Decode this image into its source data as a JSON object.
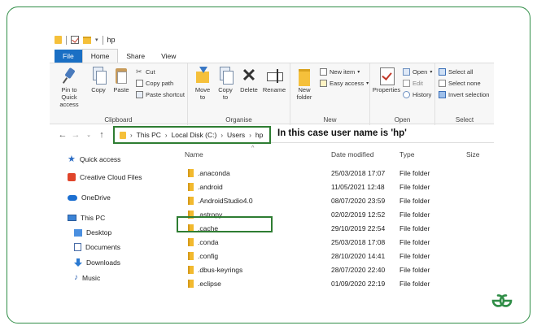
{
  "window": {
    "title": "hp",
    "tabs": [
      "File",
      "Home",
      "Share",
      "View"
    ]
  },
  "ribbon": {
    "clipboard": {
      "label": "Clipboard",
      "pin": "Pin to Quick access",
      "copy": "Copy",
      "paste": "Paste",
      "cut": "Cut",
      "copy_path": "Copy path",
      "paste_shortcut": "Paste shortcut"
    },
    "organise": {
      "label": "Organise",
      "move_to": "Move to",
      "copy_to": "Copy to",
      "delete": "Delete",
      "rename": "Rename"
    },
    "new": {
      "label": "New",
      "new_folder": "New folder",
      "new_item": "New item",
      "easy_access": "Easy access"
    },
    "open": {
      "label": "Open",
      "properties": "Properties",
      "open": "Open",
      "edit": "Edit",
      "history": "History"
    },
    "select": {
      "label": "Select",
      "select_all": "Select all",
      "select_none": "Select none",
      "invert": "Invert selection"
    }
  },
  "address": {
    "crumbs": [
      "This PC",
      "Local Disk (C:)",
      "Users",
      "hp"
    ]
  },
  "annotation": "In this case user name is 'hp'",
  "nav": {
    "quick_access": "Quick access",
    "creative_cloud": "Creative Cloud Files",
    "onedrive": "OneDrive",
    "this_pc": "This PC",
    "desktop": "Desktop",
    "documents": "Documents",
    "downloads": "Downloads",
    "music": "Music"
  },
  "list": {
    "columns": [
      "Name",
      "Date modified",
      "Type",
      "Size"
    ],
    "rows": [
      {
        "name": ".anaconda",
        "date": "25/03/2018 17:07",
        "type": "File folder"
      },
      {
        "name": ".android",
        "date": "11/05/2021 12:48",
        "type": "File folder"
      },
      {
        "name": ".AndroidStudio4.0",
        "date": "08/07/2020 23:59",
        "type": "File folder"
      },
      {
        "name": ".astropy",
        "date": "02/02/2019 12:52",
        "type": "File folder"
      },
      {
        "name": ".cache",
        "date": "29/10/2019 22:54",
        "type": "File folder"
      },
      {
        "name": ".conda",
        "date": "25/03/2018 17:08",
        "type": "File folder"
      },
      {
        "name": ".config",
        "date": "28/10/2020 14:41",
        "type": "File folder"
      },
      {
        "name": ".dbus-keyrings",
        "date": "28/07/2020 22:40",
        "type": "File folder"
      },
      {
        "name": ".eclipse",
        "date": "01/09/2020 22:19",
        "type": "File folder"
      }
    ]
  },
  "colors": {
    "accent_green": "#2e7d32",
    "file_tab_blue": "#1a6fc4",
    "folder_yellow": "#f2b92e"
  }
}
